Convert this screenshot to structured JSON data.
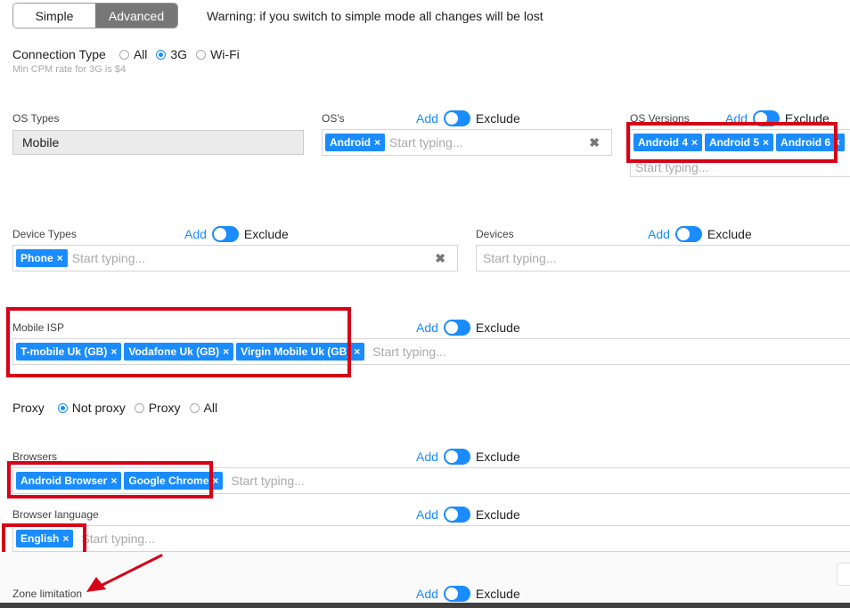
{
  "mode": {
    "simple_label": "Simple",
    "advanced_label": "Advanced",
    "warning": "Warning: if you switch to simple mode all changes will be lost"
  },
  "connection": {
    "label": "Connection Type",
    "options": [
      "All",
      "3G",
      "Wi-Fi"
    ],
    "selected": "3G",
    "hint": "Min CPM rate for 3G is $4"
  },
  "toggle": {
    "add": "Add",
    "exclude": "Exclude"
  },
  "placeholder": "Start typing...",
  "os_types": {
    "label": "OS Types",
    "value": "Mobile"
  },
  "oss": {
    "label": "OS's",
    "chips": [
      "Android"
    ]
  },
  "os_versions": {
    "label": "OS Versions",
    "chips": [
      "Android 4",
      "Android 5",
      "Android 6"
    ]
  },
  "device_types": {
    "label": "Device Types",
    "chips": [
      "Phone"
    ]
  },
  "devices": {
    "label": "Devices"
  },
  "mobile_isp": {
    "label": "Mobile ISP",
    "chips": [
      "T-mobile Uk (GB)",
      "Vodafone Uk (GB)",
      "Virgin Mobile Uk (GB)"
    ]
  },
  "proxy": {
    "label": "Proxy",
    "options": [
      "Not proxy",
      "Proxy",
      "All"
    ],
    "selected": "Not proxy"
  },
  "browsers": {
    "label": "Browsers",
    "chips": [
      "Android Browser",
      "Google Chrome"
    ]
  },
  "browser_language": {
    "label": "Browser language",
    "chips": [
      "English"
    ]
  },
  "zone_limitation": {
    "label": "Zone limitation"
  },
  "colors": {
    "accent": "#1a8cff",
    "highlight": "#d70018",
    "mode_active": "#777777"
  }
}
